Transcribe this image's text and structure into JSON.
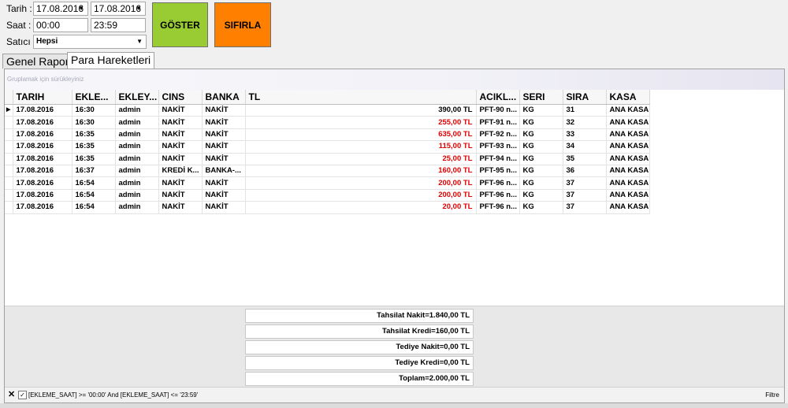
{
  "filters": {
    "tarih_label": "Tarih :",
    "tarih_from": "17.08.2016",
    "tarih_to": "17.08.2016",
    "saat_label": "Saat :",
    "saat_from": "00:00",
    "saat_to": "23:59",
    "satici_label": "Satıcı :",
    "satici_value": "Hepsi"
  },
  "buttons": {
    "goster": "GÖSTER",
    "sifirla": "SIFIRLA",
    "goster_color": "#99cc33",
    "sifirla_color": "#ff8000"
  },
  "tabs": [
    {
      "label": "Genel Rapor"
    },
    {
      "label": "Para Hareketleri"
    }
  ],
  "grid": {
    "group_hint": "Gruplamak için sürükleyiniz",
    "columns": [
      "TARIH",
      "EKLE...",
      "EKLEY...",
      "CINS",
      "BANKA",
      "TL",
      "ACIKL...",
      "SERI",
      "SIRA",
      "KASA"
    ],
    "rows": [
      {
        "tarih": "17.08.2016",
        "saat": "16:30",
        "ekleyen": "admin",
        "cins": "NAKİT",
        "banka": "NAKİT",
        "tl": "390,00 TL",
        "red": false,
        "aciklama": "PFT-90 n...",
        "seri": "KG",
        "sira": "31",
        "kasa": "ANA KASA"
      },
      {
        "tarih": "17.08.2016",
        "saat": "16:30",
        "ekleyen": "admin",
        "cins": "NAKİT",
        "banka": "NAKİT",
        "tl": "255,00 TL",
        "red": true,
        "aciklama": "PFT-91 n...",
        "seri": "KG",
        "sira": "32",
        "kasa": "ANA KASA"
      },
      {
        "tarih": "17.08.2016",
        "saat": "16:35",
        "ekleyen": "admin",
        "cins": "NAKİT",
        "banka": "NAKİT",
        "tl": "635,00 TL",
        "red": true,
        "aciklama": "PFT-92 n...",
        "seri": "KG",
        "sira": "33",
        "kasa": "ANA KASA"
      },
      {
        "tarih": "17.08.2016",
        "saat": "16:35",
        "ekleyen": "admin",
        "cins": "NAKİT",
        "banka": "NAKİT",
        "tl": "115,00 TL",
        "red": true,
        "aciklama": "PFT-93 n...",
        "seri": "KG",
        "sira": "34",
        "kasa": "ANA KASA"
      },
      {
        "tarih": "17.08.2016",
        "saat": "16:35",
        "ekleyen": "admin",
        "cins": "NAKİT",
        "banka": "NAKİT",
        "tl": "25,00 TL",
        "red": true,
        "aciklama": "PFT-94 n...",
        "seri": "KG",
        "sira": "35",
        "kasa": "ANA KASA"
      },
      {
        "tarih": "17.08.2016",
        "saat": "16:37",
        "ekleyen": "admin",
        "cins": "KREDİ K...",
        "banka": "BANKA-...",
        "tl": "160,00 TL",
        "red": true,
        "aciklama": "PFT-95 n...",
        "seri": "KG",
        "sira": "36",
        "kasa": "ANA KASA"
      },
      {
        "tarih": "17.08.2016",
        "saat": "16:54",
        "ekleyen": "admin",
        "cins": "NAKİT",
        "banka": "NAKİT",
        "tl": "200,00 TL",
        "red": true,
        "aciklama": "PFT-96 n...",
        "seri": "KG",
        "sira": "37",
        "kasa": "ANA KASA"
      },
      {
        "tarih": "17.08.2016",
        "saat": "16:54",
        "ekleyen": "admin",
        "cins": "NAKİT",
        "banka": "NAKİT",
        "tl": "200,00 TL",
        "red": true,
        "aciklama": "PFT-96 n...",
        "seri": "KG",
        "sira": "37",
        "kasa": "ANA KASA"
      },
      {
        "tarih": "17.08.2016",
        "saat": "16:54",
        "ekleyen": "admin",
        "cins": "NAKİT",
        "banka": "NAKİT",
        "tl": "20,00 TL",
        "red": true,
        "aciklama": "PFT-96 n...",
        "seri": "KG",
        "sira": "37",
        "kasa": "ANA KASA"
      }
    ]
  },
  "summary": [
    "Tahsilat Nakit=1.840,00 TL",
    "Tahsilat Kredi=160,00 TL",
    "Tediye Nakit=0,00 TL",
    "Tediye Kredi=0,00 TL",
    "Toplam=2.000,00 TL"
  ],
  "filter_bar": {
    "expression": "[EKLEME_SAAT] >= '00:00' And [EKLEME_SAAT] <= '23:59'",
    "filtre_label": "Filtre"
  },
  "icons": {
    "close": "close-icon",
    "check": "checkbox-icon",
    "dropdown": "chevron-down-icon",
    "row_indicator": "row-indicator-icon"
  }
}
